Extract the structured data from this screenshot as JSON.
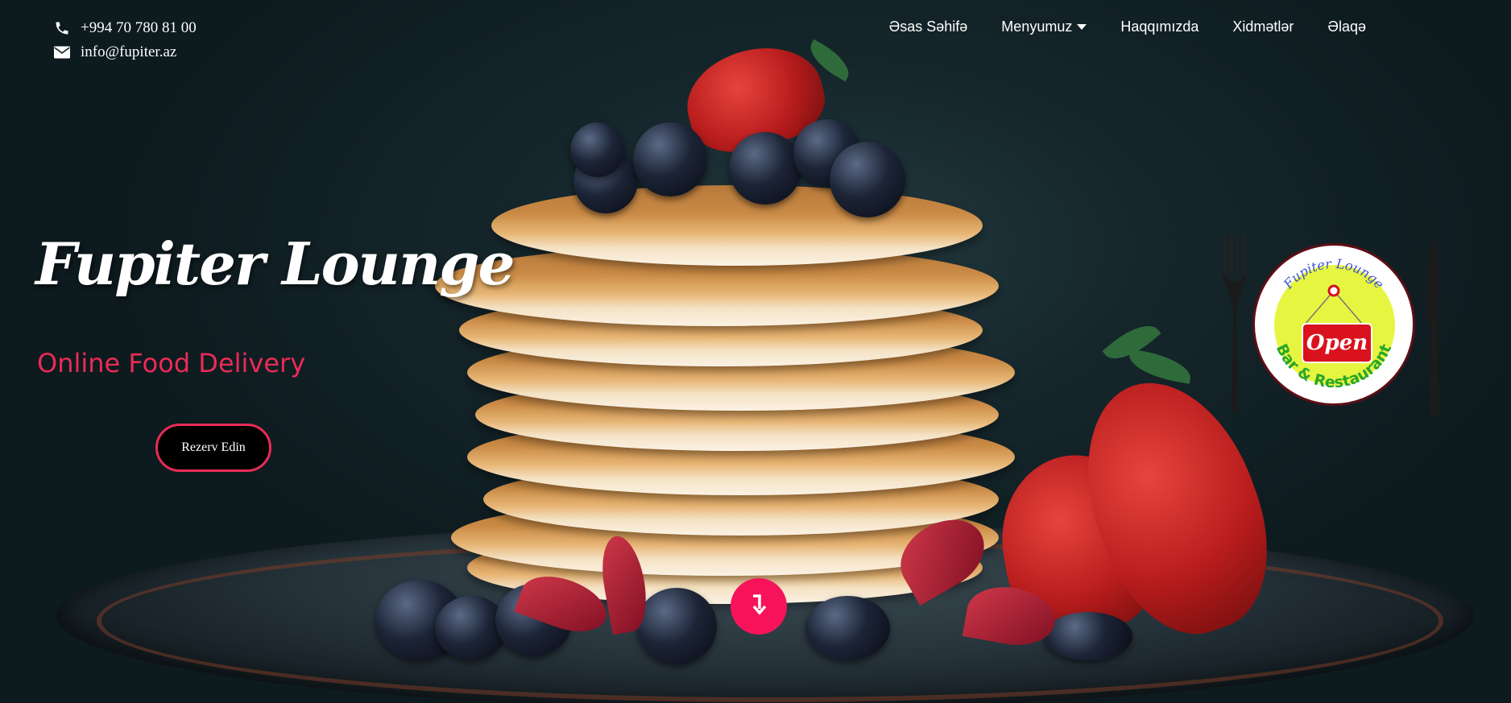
{
  "contact": {
    "phone": "+994 70 780 81 00",
    "email": "info@fupiter.az"
  },
  "nav": {
    "items": [
      {
        "label": "Əsas Səhifə"
      },
      {
        "label": "Menyumuz",
        "has_dropdown": true
      },
      {
        "label": "Haqqımızda"
      },
      {
        "label": "Xidmətlər"
      },
      {
        "label": "Əlaqə"
      }
    ]
  },
  "hero": {
    "title": "Fupiter Lounge",
    "subtitle": "Online Food Delivery",
    "cta_label": "Rezerv Edin",
    "scroll_icon": "arrow-down-icon"
  },
  "logo": {
    "top_text": "Fupiter Lounge",
    "sign_text": "Open",
    "bottom_text": "Bar & Restaurant"
  },
  "colors": {
    "accent": "#e92b56",
    "scroll_button": "#f7135a",
    "logo_fill": "#e6f540",
    "logo_sign": "#d9121e",
    "logo_top_text": "#3b4fd1",
    "logo_bottom_text": "#2aa52a"
  }
}
